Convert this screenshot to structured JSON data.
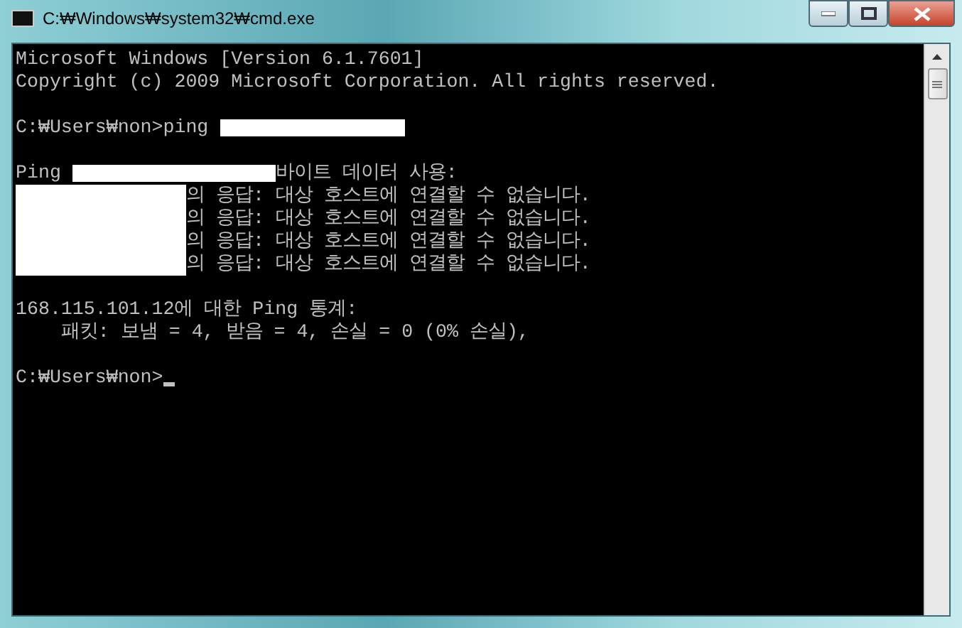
{
  "window": {
    "title": "C:₩Windows₩system32₩cmd.exe"
  },
  "console": {
    "lines": [
      {
        "kind": "text",
        "segments": [
          {
            "kind": "text",
            "text": "Microsoft Windows [Version 6.1.7601]"
          }
        ]
      },
      {
        "kind": "text",
        "segments": [
          {
            "kind": "text",
            "text": "Copyright (c) 2009 Microsoft Corporation. All rights reserved."
          }
        ]
      },
      {
        "kind": "blank"
      },
      {
        "kind": "text",
        "segments": [
          {
            "kind": "text",
            "text": "C:₩Users₩non>ping "
          },
          {
            "kind": "redacted"
          }
        ]
      },
      {
        "kind": "blank"
      },
      {
        "kind": "text",
        "segments": [
          {
            "kind": "text",
            "text": "Ping "
          },
          {
            "kind": "redacted"
          },
          {
            "kind": "text",
            "text": "바이트 데이터 사용:"
          }
        ]
      },
      {
        "kind": "text",
        "segments": [
          {
            "kind": "redacted"
          },
          {
            "kind": "text",
            "text": "의 응답: 대상 호스트에 연결할 수 없습니다."
          }
        ]
      },
      {
        "kind": "text",
        "segments": [
          {
            "kind": "redacted"
          },
          {
            "kind": "text",
            "text": "의 응답: 대상 호스트에 연결할 수 없습니다."
          }
        ]
      },
      {
        "kind": "text",
        "segments": [
          {
            "kind": "redacted"
          },
          {
            "kind": "text",
            "text": "의 응답: 대상 호스트에 연결할 수 없습니다."
          }
        ]
      },
      {
        "kind": "text",
        "segments": [
          {
            "kind": "redacted"
          },
          {
            "kind": "text",
            "text": "의 응답: 대상 호스트에 연결할 수 없습니다."
          }
        ]
      },
      {
        "kind": "blank"
      },
      {
        "kind": "text",
        "segments": [
          {
            "kind": "text",
            "text": "168.115.101.12에 대한 Ping 통계:"
          }
        ]
      },
      {
        "kind": "text",
        "segments": [
          {
            "kind": "text",
            "text": "    패킷: 보냄 = 4, 받음 = 4, 손실 = 0 (0% 손실),"
          }
        ]
      },
      {
        "kind": "blank"
      },
      {
        "kind": "prompt",
        "segments": [
          {
            "kind": "text",
            "text": "C:₩Users₩non>"
          }
        ]
      }
    ]
  }
}
